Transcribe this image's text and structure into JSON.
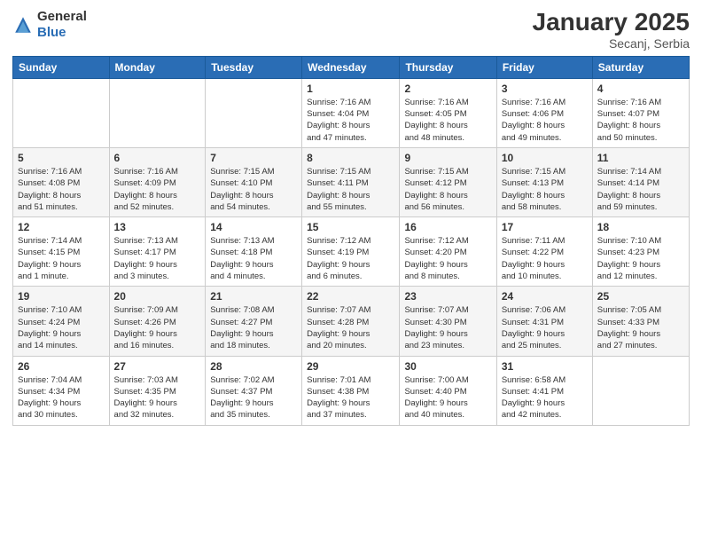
{
  "logo": {
    "general": "General",
    "blue": "Blue"
  },
  "header": {
    "month": "January 2025",
    "location": "Secanj, Serbia"
  },
  "weekdays": [
    "Sunday",
    "Monday",
    "Tuesday",
    "Wednesday",
    "Thursday",
    "Friday",
    "Saturday"
  ],
  "weeks": [
    [
      {
        "day": "",
        "info": ""
      },
      {
        "day": "",
        "info": ""
      },
      {
        "day": "",
        "info": ""
      },
      {
        "day": "1",
        "info": "Sunrise: 7:16 AM\nSunset: 4:04 PM\nDaylight: 8 hours\nand 47 minutes."
      },
      {
        "day": "2",
        "info": "Sunrise: 7:16 AM\nSunset: 4:05 PM\nDaylight: 8 hours\nand 48 minutes."
      },
      {
        "day": "3",
        "info": "Sunrise: 7:16 AM\nSunset: 4:06 PM\nDaylight: 8 hours\nand 49 minutes."
      },
      {
        "day": "4",
        "info": "Sunrise: 7:16 AM\nSunset: 4:07 PM\nDaylight: 8 hours\nand 50 minutes."
      }
    ],
    [
      {
        "day": "5",
        "info": "Sunrise: 7:16 AM\nSunset: 4:08 PM\nDaylight: 8 hours\nand 51 minutes."
      },
      {
        "day": "6",
        "info": "Sunrise: 7:16 AM\nSunset: 4:09 PM\nDaylight: 8 hours\nand 52 minutes."
      },
      {
        "day": "7",
        "info": "Sunrise: 7:15 AM\nSunset: 4:10 PM\nDaylight: 8 hours\nand 54 minutes."
      },
      {
        "day": "8",
        "info": "Sunrise: 7:15 AM\nSunset: 4:11 PM\nDaylight: 8 hours\nand 55 minutes."
      },
      {
        "day": "9",
        "info": "Sunrise: 7:15 AM\nSunset: 4:12 PM\nDaylight: 8 hours\nand 56 minutes."
      },
      {
        "day": "10",
        "info": "Sunrise: 7:15 AM\nSunset: 4:13 PM\nDaylight: 8 hours\nand 58 minutes."
      },
      {
        "day": "11",
        "info": "Sunrise: 7:14 AM\nSunset: 4:14 PM\nDaylight: 8 hours\nand 59 minutes."
      }
    ],
    [
      {
        "day": "12",
        "info": "Sunrise: 7:14 AM\nSunset: 4:15 PM\nDaylight: 9 hours\nand 1 minute."
      },
      {
        "day": "13",
        "info": "Sunrise: 7:13 AM\nSunset: 4:17 PM\nDaylight: 9 hours\nand 3 minutes."
      },
      {
        "day": "14",
        "info": "Sunrise: 7:13 AM\nSunset: 4:18 PM\nDaylight: 9 hours\nand 4 minutes."
      },
      {
        "day": "15",
        "info": "Sunrise: 7:12 AM\nSunset: 4:19 PM\nDaylight: 9 hours\nand 6 minutes."
      },
      {
        "day": "16",
        "info": "Sunrise: 7:12 AM\nSunset: 4:20 PM\nDaylight: 9 hours\nand 8 minutes."
      },
      {
        "day": "17",
        "info": "Sunrise: 7:11 AM\nSunset: 4:22 PM\nDaylight: 9 hours\nand 10 minutes."
      },
      {
        "day": "18",
        "info": "Sunrise: 7:10 AM\nSunset: 4:23 PM\nDaylight: 9 hours\nand 12 minutes."
      }
    ],
    [
      {
        "day": "19",
        "info": "Sunrise: 7:10 AM\nSunset: 4:24 PM\nDaylight: 9 hours\nand 14 minutes."
      },
      {
        "day": "20",
        "info": "Sunrise: 7:09 AM\nSunset: 4:26 PM\nDaylight: 9 hours\nand 16 minutes."
      },
      {
        "day": "21",
        "info": "Sunrise: 7:08 AM\nSunset: 4:27 PM\nDaylight: 9 hours\nand 18 minutes."
      },
      {
        "day": "22",
        "info": "Sunrise: 7:07 AM\nSunset: 4:28 PM\nDaylight: 9 hours\nand 20 minutes."
      },
      {
        "day": "23",
        "info": "Sunrise: 7:07 AM\nSunset: 4:30 PM\nDaylight: 9 hours\nand 23 minutes."
      },
      {
        "day": "24",
        "info": "Sunrise: 7:06 AM\nSunset: 4:31 PM\nDaylight: 9 hours\nand 25 minutes."
      },
      {
        "day": "25",
        "info": "Sunrise: 7:05 AM\nSunset: 4:33 PM\nDaylight: 9 hours\nand 27 minutes."
      }
    ],
    [
      {
        "day": "26",
        "info": "Sunrise: 7:04 AM\nSunset: 4:34 PM\nDaylight: 9 hours\nand 30 minutes."
      },
      {
        "day": "27",
        "info": "Sunrise: 7:03 AM\nSunset: 4:35 PM\nDaylight: 9 hours\nand 32 minutes."
      },
      {
        "day": "28",
        "info": "Sunrise: 7:02 AM\nSunset: 4:37 PM\nDaylight: 9 hours\nand 35 minutes."
      },
      {
        "day": "29",
        "info": "Sunrise: 7:01 AM\nSunset: 4:38 PM\nDaylight: 9 hours\nand 37 minutes."
      },
      {
        "day": "30",
        "info": "Sunrise: 7:00 AM\nSunset: 4:40 PM\nDaylight: 9 hours\nand 40 minutes."
      },
      {
        "day": "31",
        "info": "Sunrise: 6:58 AM\nSunset: 4:41 PM\nDaylight: 9 hours\nand 42 minutes."
      },
      {
        "day": "",
        "info": ""
      }
    ]
  ]
}
